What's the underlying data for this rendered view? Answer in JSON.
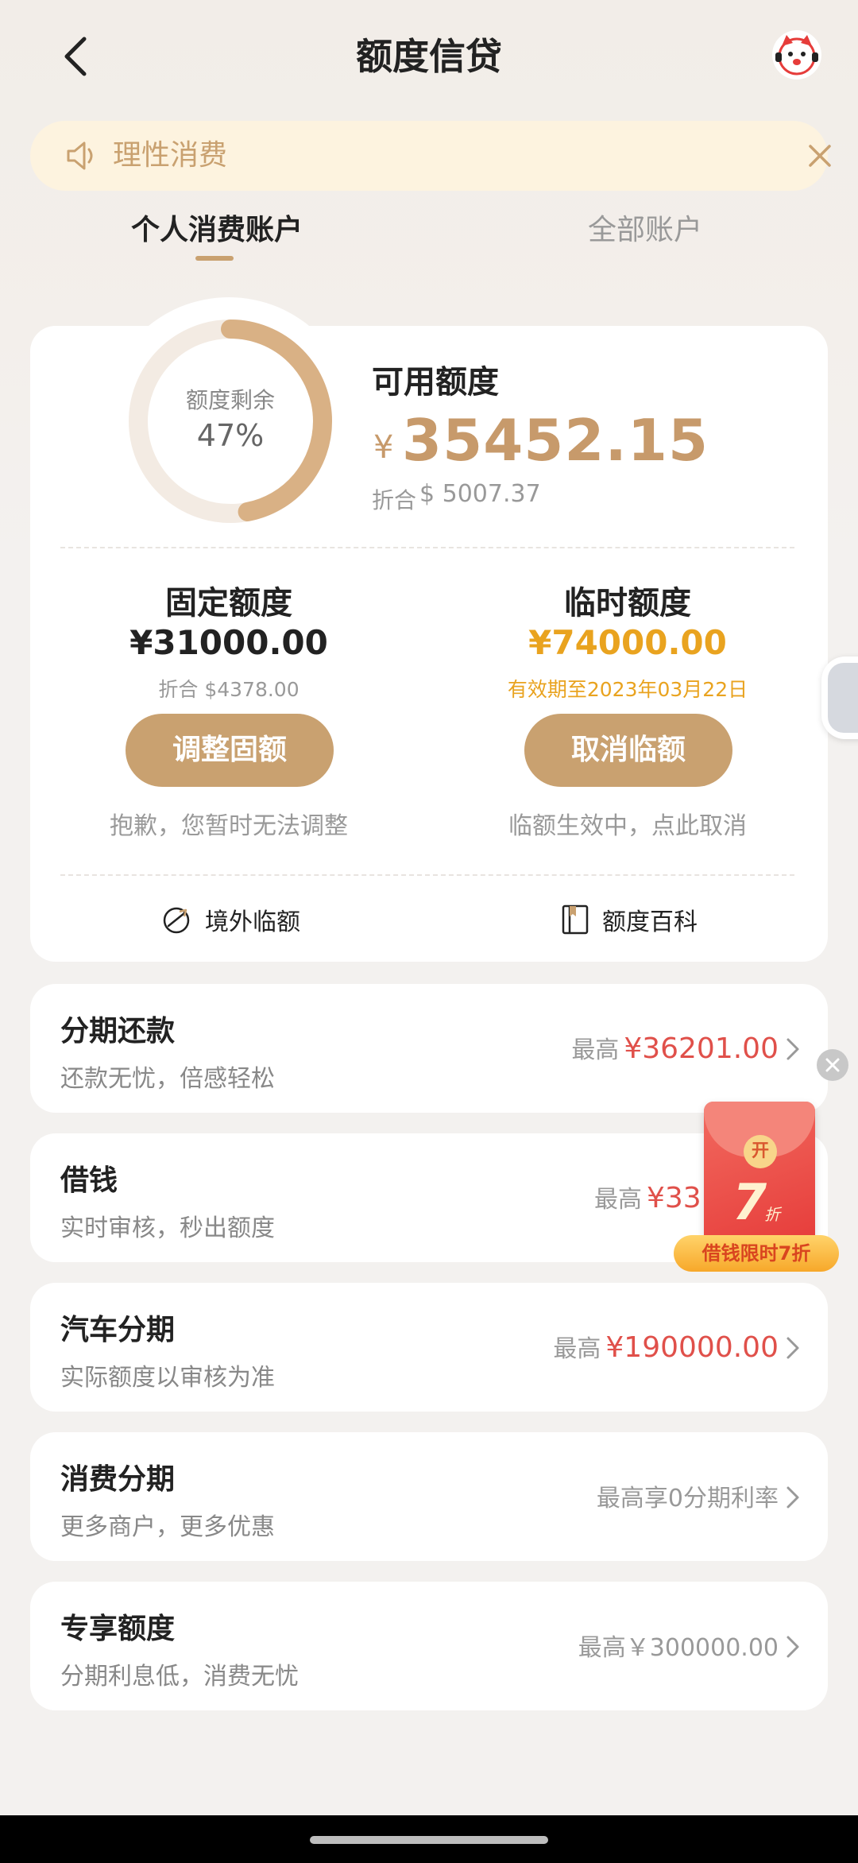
{
  "header": {
    "title": "额度信贷"
  },
  "notice": {
    "text": "理性消费"
  },
  "tabs": [
    {
      "label": "个人消费账户",
      "active": true
    },
    {
      "label": "全部账户",
      "active": false
    }
  ],
  "credit": {
    "ring_label": "额度剩余",
    "ring_percent_text": "47%",
    "ring_percent": 0.47,
    "available_title": "可用额度",
    "currency_symbol": "¥",
    "available_amount": "35452.15",
    "usd_label": "折合",
    "usd_amount": "$ 5007.37",
    "fixed": {
      "title": "固定额度",
      "amount": "¥31000.00",
      "sub": "折合 $4378.00",
      "button": "调整固额",
      "note": "抱歉，您暂时无法调整"
    },
    "temporary": {
      "title": "临时额度",
      "amount": "¥74000.00",
      "sub": "有效期至2023年03月22日",
      "button": "取消临额",
      "note": "临额生效中，点此取消"
    },
    "links": {
      "overseas": "境外临额",
      "wiki": "额度百科"
    }
  },
  "products": [
    {
      "title": "分期还款",
      "subtitle": "还款无忧，倍感轻松",
      "right_label": "最高",
      "right_value": "¥36201.00"
    },
    {
      "title": "借钱",
      "subtitle": "实时审核，秒出额度",
      "right_label": "最高",
      "right_value": "¥33"
    },
    {
      "title": "汽车分期",
      "subtitle": "实际额度以审核为准",
      "right_label": "最高",
      "right_value": "¥190000.00"
    },
    {
      "title": "消费分期",
      "subtitle": "更多商户，更多优惠",
      "right_text": "最高享0分期利率"
    },
    {
      "title": "专享额度",
      "subtitle": "分期利息低，消费无忧",
      "right_text": "最高￥300000.00"
    }
  ],
  "promo": {
    "coin": "开",
    "number": "7",
    "unit": "折",
    "ribbon": "借钱限时7折"
  },
  "colors": {
    "accent": "#c9a170",
    "orange": "#e9a31f",
    "red": "#e0504a"
  }
}
